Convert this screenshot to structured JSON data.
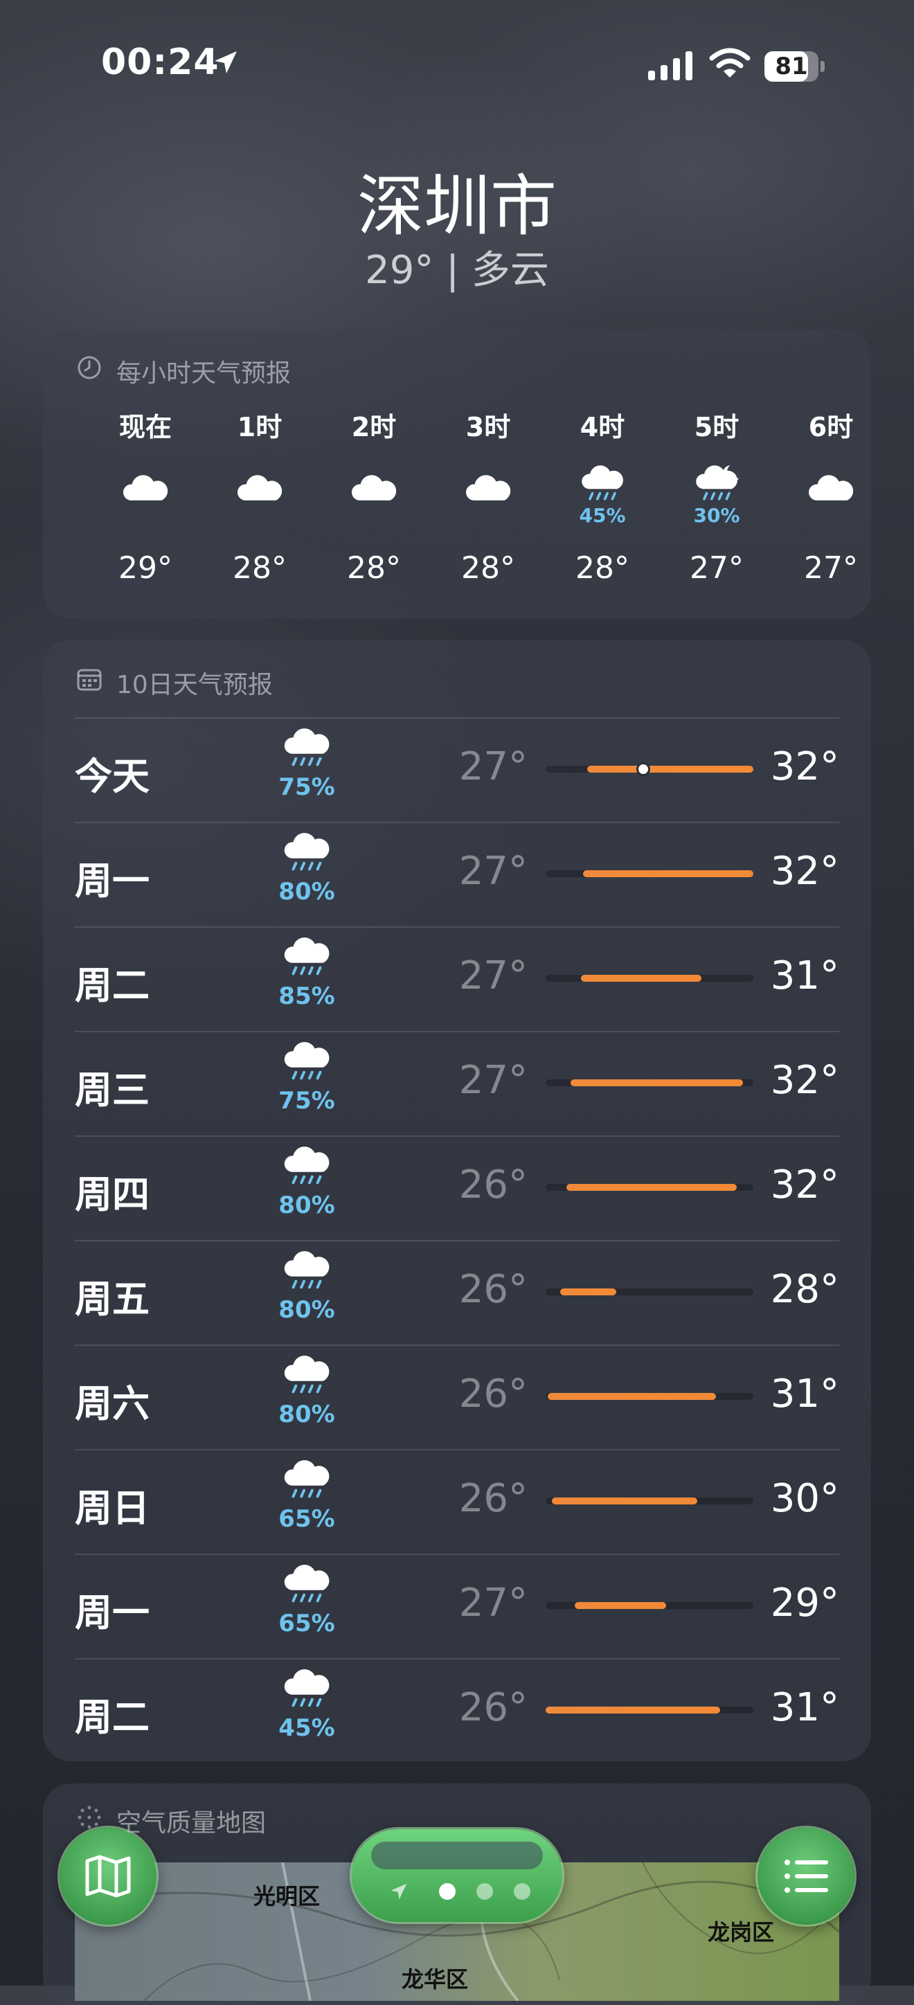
{
  "status_bar": {
    "time": "00:24",
    "battery": "81",
    "battery_level": 0.81,
    "location_icon": "location-arrow-icon"
  },
  "header": {
    "city": "深圳市",
    "current": "29° | 多云"
  },
  "hourly": {
    "title": "每小时天气预报",
    "items": [
      {
        "label": "现在",
        "icon": "cloud-icon",
        "precip": "",
        "temp": "29°"
      },
      {
        "label": "1时",
        "icon": "cloud-icon",
        "precip": "",
        "temp": "28°"
      },
      {
        "label": "2时",
        "icon": "cloud-icon",
        "precip": "",
        "temp": "28°"
      },
      {
        "label": "3时",
        "icon": "cloud-icon",
        "precip": "",
        "temp": "28°"
      },
      {
        "label": "4时",
        "icon": "cloud-rain-icon",
        "precip": "45%",
        "temp": "28°"
      },
      {
        "label": "5时",
        "icon": "cloud-moon-rain-icon",
        "precip": "30%",
        "temp": "27°"
      },
      {
        "label": "6时",
        "icon": "cloud-icon",
        "precip": "",
        "temp": "27°"
      }
    ]
  },
  "daily": {
    "title": "10日天气预报",
    "range": [
      26,
      32
    ],
    "items": [
      {
        "day": "今天",
        "precip": "75%",
        "low": "27°",
        "high": "32°",
        "bar": [
          0.2,
          1.0
        ],
        "now": 0.47
      },
      {
        "day": "周一",
        "precip": "80%",
        "low": "27°",
        "high": "32°",
        "bar": [
          0.18,
          1.0
        ]
      },
      {
        "day": "周二",
        "precip": "85%",
        "low": "27°",
        "high": "31°",
        "bar": [
          0.17,
          0.75
        ]
      },
      {
        "day": "周三",
        "precip": "75%",
        "low": "27°",
        "high": "32°",
        "bar": [
          0.12,
          0.95
        ]
      },
      {
        "day": "周四",
        "precip": "80%",
        "low": "26°",
        "high": "32°",
        "bar": [
          0.1,
          0.92
        ]
      },
      {
        "day": "周五",
        "precip": "80%",
        "low": "26°",
        "high": "28°",
        "bar": [
          0.07,
          0.34
        ]
      },
      {
        "day": "周六",
        "precip": "80%",
        "low": "26°",
        "high": "31°",
        "bar": [
          0.01,
          0.82
        ]
      },
      {
        "day": "周日",
        "precip": "65%",
        "low": "26°",
        "high": "30°",
        "bar": [
          0.03,
          0.73
        ]
      },
      {
        "day": "周一",
        "precip": "65%",
        "low": "27°",
        "high": "29°",
        "bar": [
          0.14,
          0.58
        ]
      },
      {
        "day": "周二",
        "precip": "45%",
        "low": "26°",
        "high": "31°",
        "bar": [
          0.0,
          0.84
        ]
      }
    ]
  },
  "air_quality": {
    "title": "空气质量地图",
    "map_labels": [
      "光明区",
      "龙华区",
      "龙岗区"
    ]
  },
  "bottom_bar": {
    "map_icon": "map-icon",
    "list_icon": "list-icon",
    "pages": 3,
    "active_page": 1
  },
  "colors": {
    "accent_orange": "#f08a3a",
    "precip_blue": "#6fc3ee",
    "fab_green": "#4caf5a"
  }
}
